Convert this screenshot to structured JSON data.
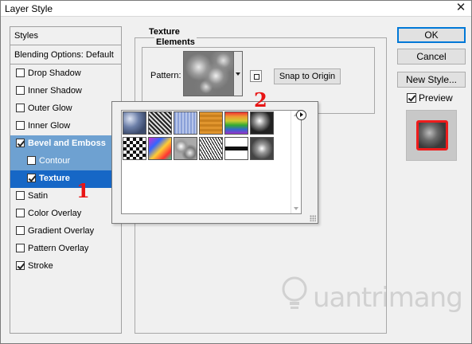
{
  "window": {
    "title": "Layer Style",
    "close_glyph": "✕"
  },
  "styles_panel": {
    "header": "Styles",
    "blending_options": "Blending Options: Default",
    "items": [
      {
        "label": "Drop Shadow",
        "checked": false
      },
      {
        "label": "Inner Shadow",
        "checked": false
      },
      {
        "label": "Outer Glow",
        "checked": false
      },
      {
        "label": "Inner Glow",
        "checked": false
      },
      {
        "label": "Bevel and Emboss",
        "checked": true
      },
      {
        "label": "Contour",
        "checked": false
      },
      {
        "label": "Texture",
        "checked": true
      },
      {
        "label": "Satin",
        "checked": false
      },
      {
        "label": "Color Overlay",
        "checked": false
      },
      {
        "label": "Gradient Overlay",
        "checked": false
      },
      {
        "label": "Pattern Overlay",
        "checked": false
      },
      {
        "label": "Stroke",
        "checked": true
      }
    ]
  },
  "texture_panel": {
    "group_title": "Texture",
    "elements_title": "Elements",
    "pattern_label": "Pattern:",
    "snap_button": "Snap to Origin",
    "new_preset_icon": "new-preset-icon"
  },
  "pattern_picker": {
    "menu_icon": "flyout-menu-icon",
    "tile_count": 12
  },
  "buttons": {
    "ok": "OK",
    "cancel": "Cancel",
    "new_style": "New Style...",
    "preview_label": "Preview",
    "preview_checked": true
  },
  "annotations": {
    "one": "1",
    "two": "2",
    "color": "#e81515"
  },
  "watermark": "uantrimang",
  "colors": {
    "selection_light": "#6ea1d1",
    "selection_dark": "#1667c6",
    "preview_border": "#ee1c1c"
  }
}
